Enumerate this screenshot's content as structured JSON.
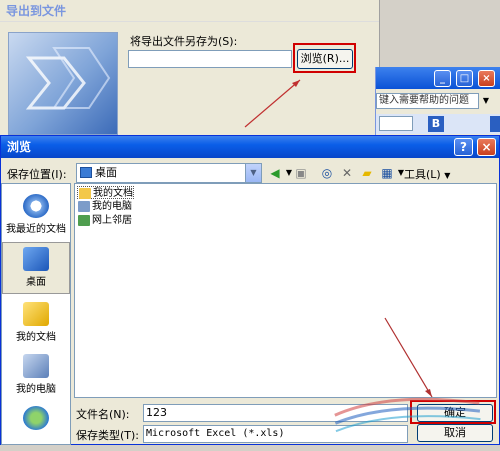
{
  "export_wizard": {
    "title": "导出到文件",
    "save_as_label": "将导出文件另存为(S):",
    "path_value": "",
    "browse_label": "浏览(R)..."
  },
  "excel_window": {
    "help_placeholder": "键入需要帮助的问题",
    "controls": [
      "_",
      "□",
      "×"
    ]
  },
  "dialog": {
    "title": "浏览",
    "help_btn": "?",
    "close_btn": "×",
    "save_in_label": "保存位置(I):",
    "location_value": "桌面",
    "tools_label": "工具(L)"
  },
  "places": [
    {
      "label": "我最近的文档",
      "icon": "recent-documents-icon"
    },
    {
      "label": "桌面",
      "icon": "desktop-icon"
    },
    {
      "label": "我的文档",
      "icon": "my-documents-icon"
    },
    {
      "label": "我的电脑",
      "icon": "my-computer-icon"
    },
    {
      "label": "",
      "icon": "network-places-icon"
    }
  ],
  "files": [
    {
      "name": "我的文档",
      "icon": "folder-icon",
      "selected": true
    },
    {
      "name": "我的电脑",
      "icon": "computer-icon",
      "selected": false
    },
    {
      "name": "网上邻居",
      "icon": "network-icon",
      "selected": false
    }
  ],
  "filename_label": "文件名(N):",
  "filename_value": "123",
  "filetype_label": "保存类型(T):",
  "filetype_value": "Microsoft Excel (*.xls)",
  "ok_label": "确定",
  "cancel_label": "取消",
  "colors": {
    "title_blue": "#0a52d6",
    "highlight_red": "#d00000"
  }
}
